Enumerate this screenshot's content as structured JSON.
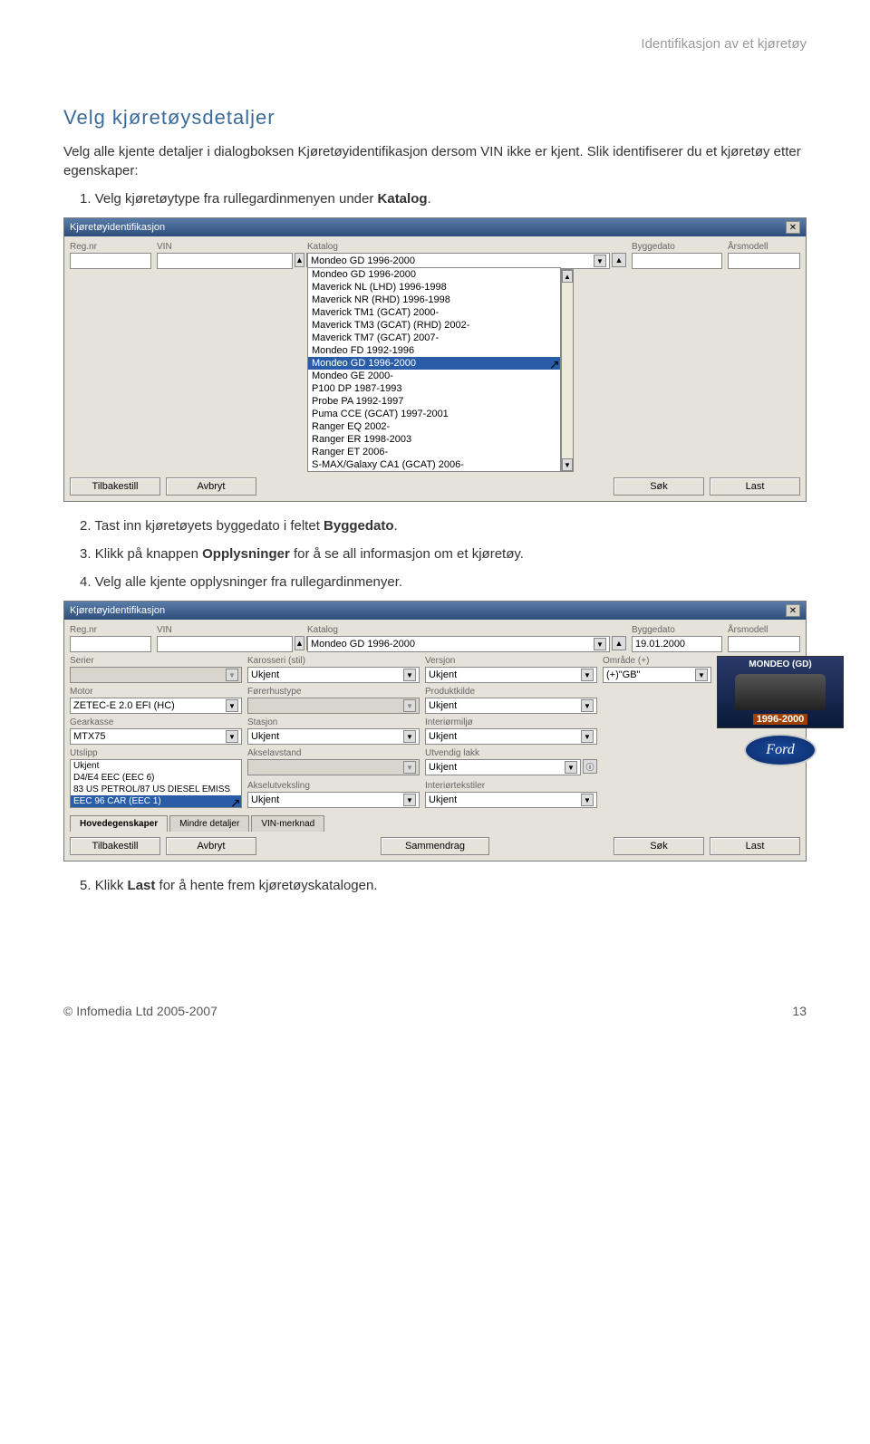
{
  "header": {
    "right": "Identifikasjon av et kjøretøy"
  },
  "section": {
    "title": "Velg kjøretøysdetaljer",
    "intro": "Velg alle kjente detaljer i dialogboksen Kjøretøyidentifikasjon dersom VIN ikke er kjent. Slik identifiserer du et kjøretøy etter egenskaper:",
    "step1_pre": "Velg kjøretøytype fra rullegardinmenyen under ",
    "step1_bold": "Katalog",
    "step1_post": ".",
    "step2_pre": "Tast inn kjøretøyets byggedato i feltet ",
    "step2_bold": "Byggedato",
    "step2_post": ".",
    "step3_pre": "Klikk på knappen ",
    "step3_bold": "Opplysninger",
    "step3_post": " for å se all informasjon om et kjøretøy.",
    "step4": "Velg alle kjente opplysninger fra rullegardinmenyer.",
    "step5_pre": "Klikk ",
    "step5_bold": "Last",
    "step5_post": " for å hente frem kjøretøyskatalogen."
  },
  "dlg1": {
    "title": "Kjøretøyidentifikasjon",
    "labels": {
      "regnr": "Reg.nr",
      "vin": "VIN",
      "katalog": "Katalog",
      "byggedato": "Byggedato",
      "arsmodell": "Årsmodell"
    },
    "katalog_value": "Mondeo GD 1996-2000",
    "btn_tilbakestill": "Tilbakestill",
    "btn_avbryt": "Avbryt",
    "btn_sok": "Søk",
    "btn_last": "Last",
    "list": [
      "Mondeo GD 1996-2000",
      "Maverick NL (LHD) 1996-1998",
      "Maverick NR (RHD) 1996-1998",
      "Maverick TM1 (GCAT) 2000-",
      "Maverick TM3 (GCAT) (RHD) 2002-",
      "Maverick TM7 (GCAT) 2007-",
      "Mondeo FD 1992-1996",
      "Mondeo GD 1996-2000",
      "Mondeo GE 2000-",
      "P100 DP 1987-1993",
      "Probe PA 1992-1997",
      "Puma CCE (GCAT) 1997-2001",
      "Ranger EQ 2002-",
      "Ranger ER 1998-2003",
      "Ranger ET 2006-",
      "S-MAX/Galaxy CA1 (GCAT) 2006-"
    ],
    "selected_index": 7
  },
  "dlg2": {
    "title": "Kjøretøyidentifikasjon",
    "row1": {
      "regnr": {
        "label": "Reg.nr",
        "value": ""
      },
      "vin": {
        "label": "VIN",
        "value": ""
      },
      "katalog": {
        "label": "Katalog",
        "value": "Mondeo GD 1996-2000"
      },
      "byggedato": {
        "label": "Byggedato",
        "value": "19.01.2000"
      },
      "arsmodell": {
        "label": "Årsmodell",
        "value": ""
      }
    },
    "row2": {
      "serier": {
        "label": "Serier",
        "value": ""
      },
      "karosseri": {
        "label": "Karosseri (stil)",
        "value": "Ukjent"
      },
      "versjon": {
        "label": "Versjon",
        "value": "Ukjent"
      },
      "omrade": {
        "label": "Område (+)",
        "value": "(+)\"GB\""
      }
    },
    "row3": {
      "motor": {
        "label": "Motor",
        "value": "ZETEC-E 2.0 EFI (HC)"
      },
      "forethustype": {
        "label": "Førerhustype",
        "value": ""
      },
      "produktkilde": {
        "label": "Produktkilde",
        "value": "Ukjent"
      }
    },
    "row4": {
      "gearkasse": {
        "label": "Gearkasse",
        "value": "MTX75"
      },
      "stasjon": {
        "label": "Stasjon",
        "value": "Ukjent"
      },
      "interiormiljo": {
        "label": "Interiørmiljø",
        "value": "Ukjent"
      }
    },
    "row5": {
      "utslipp_label": "Utslipp",
      "utslipp_list": [
        "Ukjent",
        "D4/E4 EEC (EEC 6)",
        "83 US PETROL/87 US DIESEL EMISS",
        "EEC 96 CAR (EEC 1)"
      ],
      "utslipp_selected": 3,
      "akselavstand": {
        "label": "Akselavstand",
        "value": ""
      },
      "utvendiglakk": {
        "label": "Utvendig lakk",
        "value": "Ukjent"
      }
    },
    "row6": {
      "akselutveksling": {
        "label": "Akselutveksling",
        "value": "Ukjent"
      },
      "interiortekstiler": {
        "label": "Interiørtekstiler",
        "value": "Ukjent"
      }
    },
    "car": {
      "name": "MONDEO (GD)",
      "years": "1996-2000",
      "logo": "Ford"
    },
    "tabs": {
      "hoved": "Hovedegenskaper",
      "mindre": "Mindre detaljer",
      "vin": "VIN-merknad"
    },
    "btn_tilbakestill": "Tilbakestill",
    "btn_avbryt": "Avbryt",
    "btn_sammendrag": "Sammendrag",
    "btn_sok": "Søk",
    "btn_last": "Last"
  },
  "footer": {
    "copyright": "© Infomedia Ltd 2005-2007",
    "page": "13"
  }
}
